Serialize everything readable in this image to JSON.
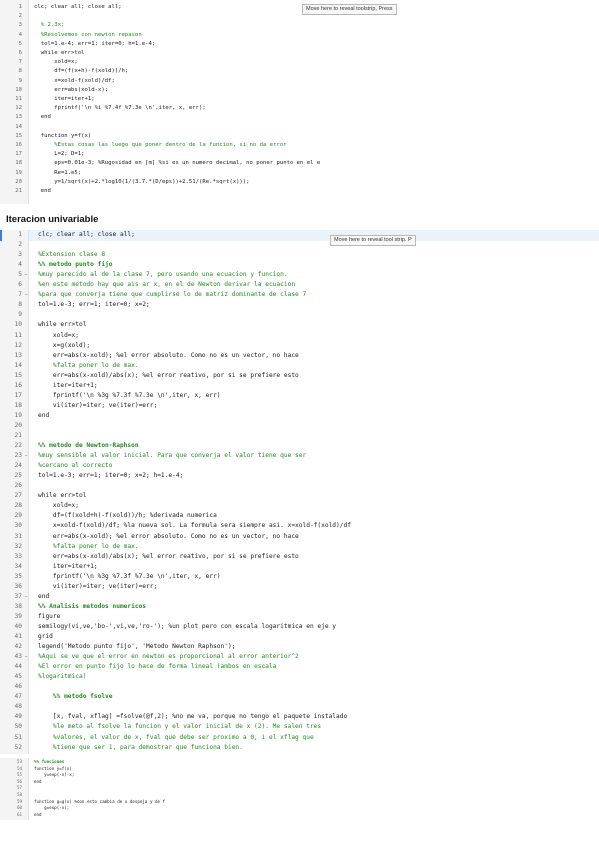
{
  "section_title": "Iteracion univariable",
  "tooltip_top": "Move here to reveal toolstrip, Press",
  "tooltip_mid": "Move here to reveal tool strip. P",
  "panel_top": [
    {
      "n": "1",
      "f": "",
      "t": "clc; clear all; close all;",
      "k": "code"
    },
    {
      "n": "2",
      "f": "",
      "t": "",
      "k": "code"
    },
    {
      "n": "3",
      "f": "",
      "t": "  % 2.3x;",
      "k": "cm"
    },
    {
      "n": "4",
      "f": "",
      "t": "  %Resolvemos con newton repason",
      "k": "cm"
    },
    {
      "n": "5",
      "f": "",
      "t": "  tol=1.e-4; err=1; iter=0; h=1.e-4;",
      "k": "code"
    },
    {
      "n": "6",
      "f": "",
      "t": "  while err>tol",
      "k": "code"
    },
    {
      "n": "7",
      "f": "",
      "t": "      xold=x;",
      "k": "code"
    },
    {
      "n": "8",
      "f": "",
      "t": "      df=(f(x+h)-f(xold))/h;",
      "k": "code"
    },
    {
      "n": "9",
      "f": "",
      "t": "      x=xold-f(xold)/df;",
      "k": "code"
    },
    {
      "n": "10",
      "f": "",
      "t": "      err=abs(xold-x);",
      "k": "code"
    },
    {
      "n": "11",
      "f": "",
      "t": "      iter=iter+1;",
      "k": "code"
    },
    {
      "n": "12",
      "f": "",
      "t": "      fprintf('\\n %i %7.4f %7.3e \\n',iter, x, err);",
      "k": "code"
    },
    {
      "n": "13",
      "f": "",
      "t": "  end",
      "k": "code"
    },
    {
      "n": "14",
      "f": "",
      "t": "",
      "k": "code"
    },
    {
      "n": "15",
      "f": "",
      "t": "  function y=f(x)",
      "k": "code"
    },
    {
      "n": "16",
      "f": "",
      "t": "      %Estas cosas las luego que poner dentro de la funcion, si no da error",
      "k": "cm"
    },
    {
      "n": "17",
      "f": "",
      "t": "      L=2; D=1;",
      "k": "code"
    },
    {
      "n": "18",
      "f": "",
      "t": "      eps=0.01e-3; %Rugosidad en [m] %si es un numero decimal, no poner punto en el e",
      "k": "code"
    },
    {
      "n": "19",
      "f": "",
      "t": "      Re=1.e5;",
      "k": "code"
    },
    {
      "n": "20",
      "f": "",
      "t": "      y=1/sqrt(x)+2.*log10(1/(3.7.*(D/eps))+2.51/(Re.*sqrt(x)));",
      "k": "code"
    },
    {
      "n": "21",
      "f": "",
      "t": "  end",
      "k": "code"
    }
  ],
  "panel_main": [
    {
      "n": "1",
      "f": "",
      "t": "clc; clear all; close all;",
      "k": "code"
    },
    {
      "n": "2",
      "f": "",
      "t": "",
      "k": "code"
    },
    {
      "n": "3",
      "f": "",
      "t": "%Extension clase 8",
      "k": "cm"
    },
    {
      "n": "4",
      "f": "",
      "t": "%% metodo punto fijo",
      "k": "sec"
    },
    {
      "n": "5",
      "f": "−",
      "t": "%muy parecido al de la clase 7, pero usando una ecuacion y funcion.",
      "k": "cm"
    },
    {
      "n": "6",
      "f": "",
      "t": "%en este metodo hay que ais ar x, en el de Newton derivar la ecuacion",
      "k": "cm"
    },
    {
      "n": "7",
      "f": "−",
      "t": "%para que converja tiene que cumplirse lo de matriz dominante de clase 7",
      "k": "cm"
    },
    {
      "n": "8",
      "f": "",
      "t": "tol=1.e-3; err=1; iter=0; x=2;",
      "k": "code"
    },
    {
      "n": "9",
      "f": "",
      "t": "",
      "k": "code"
    },
    {
      "n": "10",
      "f": "",
      "t": "while err>tol",
      "k": "code"
    },
    {
      "n": "11",
      "f": "",
      "t": "    xold=x;",
      "k": "code"
    },
    {
      "n": "12",
      "f": "",
      "t": "    x=g(xold);",
      "k": "code"
    },
    {
      "n": "13",
      "f": "",
      "t": "    err=abs(x-xold); %el error absoluto. Como no es un vector, no hace",
      "k": "code"
    },
    {
      "n": "14",
      "f": "",
      "t": "    %falta poner lo de max.",
      "k": "cm"
    },
    {
      "n": "15",
      "f": "",
      "t": "    err=abs(x-xold)/abs(x); %el error reativo, por si se prefiere esto",
      "k": "code"
    },
    {
      "n": "16",
      "f": "",
      "t": "    iter=iter+1;",
      "k": "code"
    },
    {
      "n": "17",
      "f": "",
      "t": "    fprintf('\\n %3g %7.3f %7.3e \\n',iter, x, err)",
      "k": "code"
    },
    {
      "n": "18",
      "f": "",
      "t": "    vi(iter)=iter; ve(iter)=err;",
      "k": "code"
    },
    {
      "n": "19",
      "f": "",
      "t": "end",
      "k": "code"
    },
    {
      "n": "20",
      "f": "",
      "t": "",
      "k": "code"
    },
    {
      "n": "21",
      "f": "",
      "t": "",
      "k": "code"
    },
    {
      "n": "22",
      "f": "",
      "t": "%% metodo de Newton-Raphson",
      "k": "sec"
    },
    {
      "n": "23",
      "f": "−",
      "t": "%muy sensible al valor inicial. Para que converja el valor tiene que ser",
      "k": "cm"
    },
    {
      "n": "24",
      "f": "",
      "t": "%cercano al correcto",
      "k": "cm"
    },
    {
      "n": "25",
      "f": "",
      "t": "tol=1.e-3; err=1; iter=0; x=2; h=1.e-4;",
      "k": "code"
    },
    {
      "n": "26",
      "f": "",
      "t": "",
      "k": "code"
    },
    {
      "n": "27",
      "f": "",
      "t": "while err>tol",
      "k": "code"
    },
    {
      "n": "28",
      "f": "",
      "t": "    xold=x;",
      "k": "code"
    },
    {
      "n": "29",
      "f": "",
      "t": "    df=(f(xold+h)-f(xold))/h; %derivada numerica",
      "k": "code"
    },
    {
      "n": "30",
      "f": "",
      "t": "    x=xold-f(xold)/df; %la nueva sol. La formula sera siempre asi. x=xold-f(xold)/df",
      "k": "code"
    },
    {
      "n": "31",
      "f": "",
      "t": "    err=abs(x-xold); %el error absoluto. Como no es un vector, no hace",
      "k": "code"
    },
    {
      "n": "32",
      "f": "",
      "t": "    %falta poner lo de max.",
      "k": "cm"
    },
    {
      "n": "33",
      "f": "",
      "t": "    err=abs(x-xold)/abs(x); %el error reativo, por si se prefiere esto",
      "k": "code"
    },
    {
      "n": "34",
      "f": "",
      "t": "    iter=iter+1;",
      "k": "code"
    },
    {
      "n": "35",
      "f": "",
      "t": "    fprintf('\\n %3g %7.3f %7.3e \\n',iter, x, err)",
      "k": "code"
    },
    {
      "n": "36",
      "f": "",
      "t": "    vi(iter)=iter; ve(iter)=err;",
      "k": "code"
    },
    {
      "n": "37",
      "f": "−",
      "t": "end",
      "k": "code"
    },
    {
      "n": "38",
      "f": "",
      "t": "%% Analisis metodos numericos",
      "k": "sec"
    },
    {
      "n": "39",
      "f": "",
      "t": "figure",
      "k": "code"
    },
    {
      "n": "40",
      "f": "",
      "t": "semilogy(vi,ve,'bo-',vi,ve,'ro-'); %un plot pero con escala logaritmica en eje y",
      "k": "code"
    },
    {
      "n": "41",
      "f": "",
      "t": "grid",
      "k": "code"
    },
    {
      "n": "42",
      "f": "",
      "t": "legend('Metodo punto fijo', 'Metodo Newton Raphson');",
      "k": "code"
    },
    {
      "n": "43",
      "f": "−",
      "t": "%Aqui se ve que el error en newton es proporcional al error anterior^2",
      "k": "cm"
    },
    {
      "n": "44",
      "f": "",
      "t": "%El error en punto fijo lo hace de forma lineal (ambos en escala",
      "k": "cm"
    },
    {
      "n": "45",
      "f": "",
      "t": "%logaritmica)",
      "k": "cm"
    },
    {
      "n": "46",
      "f": "",
      "t": "",
      "k": "code"
    },
    {
      "n": "47",
      "f": "",
      "t": "    %% metodo fsolve",
      "k": "sec"
    },
    {
      "n": "48",
      "f": "",
      "t": "",
      "k": "code"
    },
    {
      "n": "49",
      "f": "",
      "t": "    [x, fval, xflag] =fsolve(@f,2); %no me va, porque no tengo el paquete instalado",
      "k": "code"
    },
    {
      "n": "50",
      "f": "",
      "t": "    %le meto al fsolve la funcion y el valor inicial de x (2). Me salen tres",
      "k": "cm"
    },
    {
      "n": "51",
      "f": "",
      "t": "    %valores, el valor de x, fval que debe ser proximo a 0, i el xflag que",
      "k": "cm"
    },
    {
      "n": "52",
      "f": "",
      "t": "    %tiene que ser 1, para demostrar que funciona bien.",
      "k": "cm"
    }
  ],
  "panel_bottom": [
    {
      "n": "53",
      "f": "",
      "t": "%% funciones",
      "k": "sec"
    },
    {
      "n": "54",
      "f": "",
      "t": "function y=f(x)",
      "k": "code"
    },
    {
      "n": "55",
      "f": "",
      "t": "    y=exp(-x)-x;",
      "k": "code"
    },
    {
      "n": "56",
      "f": "",
      "t": "end",
      "k": "code"
    },
    {
      "n": "57",
      "f": "",
      "t": "",
      "k": "code"
    },
    {
      "n": "58",
      "f": "",
      "t": "",
      "k": "code"
    },
    {
      "n": "59",
      "f": "",
      "t": "function g=g(x) %con esto cambia de x despeja y de f",
      "k": "code"
    },
    {
      "n": "60",
      "f": "",
      "t": "    g=exp(-x);",
      "k": "code"
    },
    {
      "n": "61",
      "f": "",
      "t": "end",
      "k": "code"
    }
  ]
}
